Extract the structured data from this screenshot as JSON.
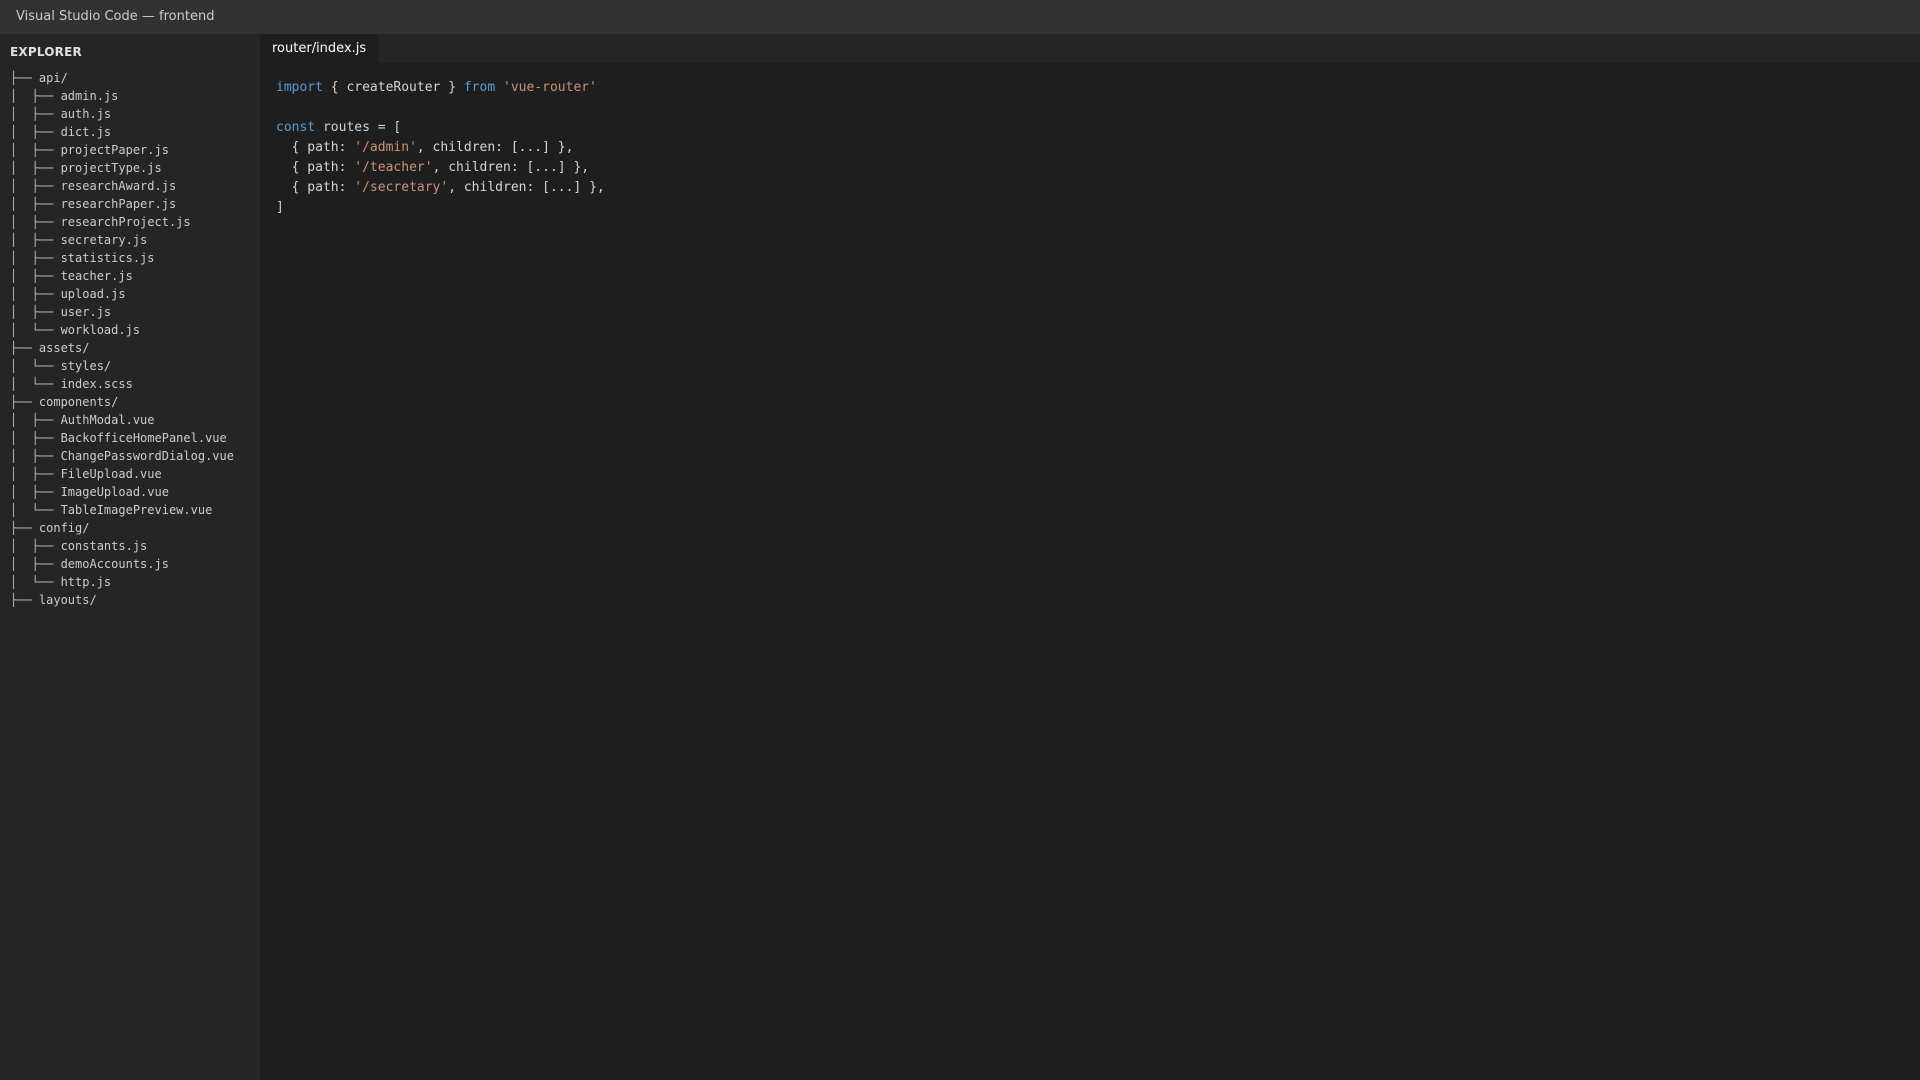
{
  "window": {
    "title": "Visual Studio Code — frontend"
  },
  "sidebar": {
    "header": "EXPLORER",
    "items": [
      {
        "guide": "├── ",
        "label": "api/"
      },
      {
        "guide": "│  ├── ",
        "label": "admin.js"
      },
      {
        "guide": "│  ├── ",
        "label": "auth.js"
      },
      {
        "guide": "│  ├── ",
        "label": "dict.js"
      },
      {
        "guide": "│  ├── ",
        "label": "projectPaper.js"
      },
      {
        "guide": "│  ├── ",
        "label": "projectType.js"
      },
      {
        "guide": "│  ├── ",
        "label": "researchAward.js"
      },
      {
        "guide": "│  ├── ",
        "label": "researchPaper.js"
      },
      {
        "guide": "│  ├── ",
        "label": "researchProject.js"
      },
      {
        "guide": "│  ├── ",
        "label": "secretary.js"
      },
      {
        "guide": "│  ├── ",
        "label": "statistics.js"
      },
      {
        "guide": "│  ├── ",
        "label": "teacher.js"
      },
      {
        "guide": "│  ├── ",
        "label": "upload.js"
      },
      {
        "guide": "│  ├── ",
        "label": "user.js"
      },
      {
        "guide": "│  └── ",
        "label": "workload.js"
      },
      {
        "guide": "├── ",
        "label": "assets/"
      },
      {
        "guide": "│  └── ",
        "label": "styles/"
      },
      {
        "guide": "│  └── ",
        "label": "index.scss"
      },
      {
        "guide": "├── ",
        "label": "components/"
      },
      {
        "guide": "│  ├── ",
        "label": "AuthModal.vue"
      },
      {
        "guide": "│  ├── ",
        "label": "BackofficeHomePanel.vue"
      },
      {
        "guide": "│  ├── ",
        "label": "ChangePasswordDialog.vue"
      },
      {
        "guide": "│  ├── ",
        "label": "FileUpload.vue"
      },
      {
        "guide": "│  ├── ",
        "label": "ImageUpload.vue"
      },
      {
        "guide": "│  └── ",
        "label": "TableImagePreview.vue"
      },
      {
        "guide": "├── ",
        "label": "config/"
      },
      {
        "guide": "│  ├── ",
        "label": "constants.js"
      },
      {
        "guide": "│  ├── ",
        "label": "demoAccounts.js"
      },
      {
        "guide": "│  └── ",
        "label": "http.js"
      },
      {
        "guide": "├── ",
        "label": "layouts/"
      }
    ]
  },
  "editor": {
    "active_tab": "router/index.js",
    "code_lines": [
      [
        {
          "t": "import",
          "c": "kw"
        },
        {
          "t": " { createRouter } ",
          "c": ""
        },
        {
          "t": "from",
          "c": "kw"
        },
        {
          "t": " ",
          "c": ""
        },
        {
          "t": "'vue-router'",
          "c": "str"
        }
      ],
      [],
      [
        {
          "t": "const",
          "c": "kw"
        },
        {
          "t": " routes = [",
          "c": ""
        }
      ],
      [
        {
          "t": "  { path: ",
          "c": ""
        },
        {
          "t": "'/admin'",
          "c": "str"
        },
        {
          "t": ", children: [...] },",
          "c": ""
        }
      ],
      [
        {
          "t": "  { path: ",
          "c": ""
        },
        {
          "t": "'/teacher'",
          "c": "str"
        },
        {
          "t": ", children: [...] },",
          "c": ""
        }
      ],
      [
        {
          "t": "  { path: ",
          "c": ""
        },
        {
          "t": "'/secretary'",
          "c": "str"
        },
        {
          "t": ", children: [...] },",
          "c": ""
        }
      ],
      [
        {
          "t": "]",
          "c": ""
        }
      ]
    ]
  },
  "colors": {
    "keyword": "#569cd6",
    "string": "#ce9178",
    "text": "#d4d4d4",
    "editor_bg": "#1e1e1e",
    "sidebar_bg": "#252526",
    "titlebar_bg": "#323233"
  }
}
